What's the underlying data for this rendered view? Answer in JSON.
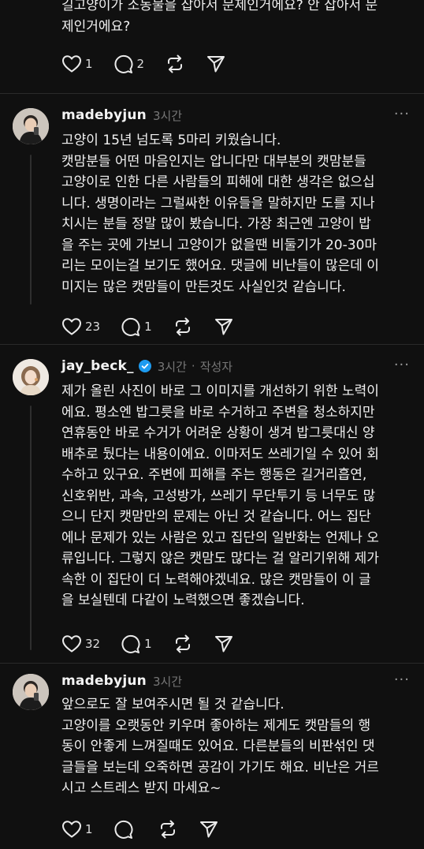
{
  "top_post": {
    "text": "길고양이가 소동물을 잡아서 문제인거에요? 안 잡아서 문\n제인거에요?",
    "likes": "1",
    "replies": "2"
  },
  "comments": [
    {
      "username": "madebyjun",
      "time": "3시간",
      "text": "고양이 15년 넘도록 5마리 키웠습니다.\n캣맘분들 어떤 마음인지는 압니다만 대부분의 캣맘분들\n고양이로 인한 다른 사람들의 피해에 대한 생각은 없으십\n니다. 생명이라는 그럴싸한 이유들을 말하지만 도를 지나\n치시는 분들 정말 많이 봤습니다. 가장 최근엔 고양이 밥\n을 주는 곳에 가보니 고양이가 없을땐 비둘기가 20-30마\n리는 모이는걸 보기도 했어요. 댓글에 비난들이 많은데 이\n미지는 많은 캣맘들이 만든것도 사실인것 같습니다.",
      "likes": "23",
      "replies": "1"
    },
    {
      "username": "jay_beck_",
      "time": "3시간",
      "separator": "·",
      "author_tag": "작성자",
      "verified": true,
      "text": "제가 올린 사진이 바로 그 이미지를 개선하기 위한 노력이\n에요. 평소엔 밥그릇을 바로 수거하고 주변을 청소하지만\n연휴동안 바로 수거가 어려운 상황이 생겨 밥그릇대신 양\n배추로 뒀다는 내용이에요. 이마저도 쓰레기일 수 있어 회\n수하고 있구요. 주변에 피해를 주는 행동은 길거리흡연,\n신호위반, 과속, 고성방가, 쓰레기 무단투기 등 너무도 많\n으니 단지 캣맘만의 문제는 아닌 것 같습니다. 어느 집단\n에나 문제가 있는 사람은 있고 집단의 일반화는 언제나 오\n류입니다. 그렇지 않은 캣맘도 많다는 걸 알리기위해 제가\n속한 이 집단이 더 노력해야겠네요. 많은 캣맘들이 이 글\n을 보실텐데 다같이 노력했으면 좋겠습니다.",
      "likes": "32",
      "replies": "1"
    },
    {
      "username": "madebyjun",
      "time": "3시간",
      "text": "앞으로도 잘 보여주시면 될 것 같습니다.\n고양이를 오랫동안 키우며 좋아하는 제게도 캣맘들의 행\n동이 안좋게 느껴질때도 있어요. 다른분들의 비판섞인 댓\n글들을 보는데 오죽하면 공감이 가기도 해요. 비난은 거르\n시고 스트레스 받지 마세요~",
      "likes": "1",
      "replies": ""
    }
  ],
  "more_label": "···",
  "colors": {
    "background": "#101010",
    "text": "#f3f3f3",
    "muted": "#777777",
    "verified": "#1d9bf0"
  }
}
